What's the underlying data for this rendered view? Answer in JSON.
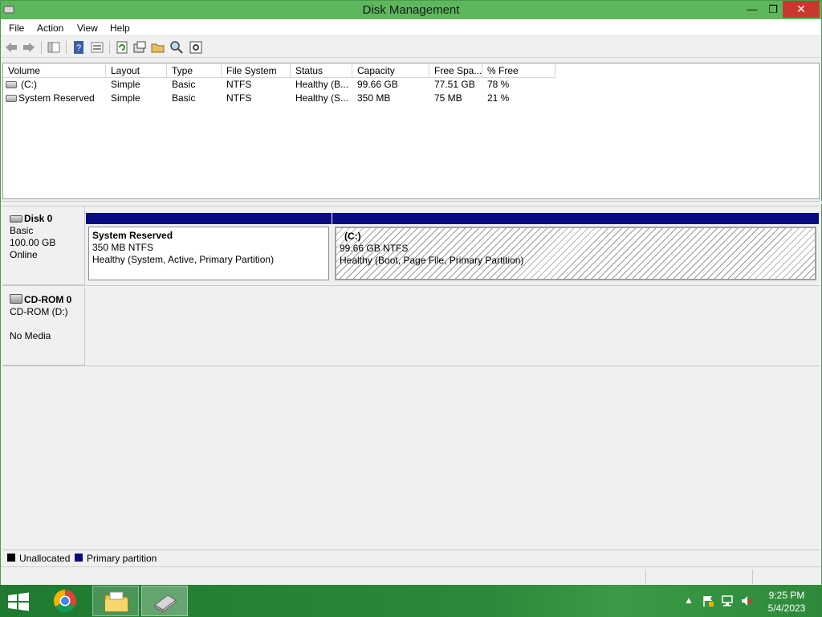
{
  "window": {
    "title": "Disk Management",
    "controls": {
      "minimize": "—",
      "maximize": "❐",
      "close": "✕"
    }
  },
  "menu": [
    "File",
    "Action",
    "View",
    "Help"
  ],
  "toolbar": {
    "icons": [
      "back-arrow-icon",
      "forward-arrow-icon",
      "properties-pane-icon",
      "help-icon",
      "show-hide-icon",
      "refresh-icon",
      "disk-properties-icon",
      "open-folder-icon",
      "search-icon",
      "settings-icon"
    ]
  },
  "volume_table": {
    "columns": [
      "Volume",
      "Layout",
      "Type",
      "File System",
      "Status",
      "Capacity",
      "Free Spa...",
      "% Free"
    ],
    "rows": [
      {
        "volume": "(C:)",
        "layout": "Simple",
        "type": "Basic",
        "fs": "NTFS",
        "status": "Healthy (B...",
        "capacity": "99.66 GB",
        "free": "77.51 GB",
        "pct": "78 %"
      },
      {
        "volume": "System Reserved",
        "layout": "Simple",
        "type": "Basic",
        "fs": "NTFS",
        "status": "Healthy (S...",
        "capacity": "350 MB",
        "free": "75 MB",
        "pct": "21 %"
      }
    ]
  },
  "disks": [
    {
      "name": "Disk 0",
      "kind": "Basic",
      "size": "100.00 GB",
      "state": "Online",
      "partitions": [
        {
          "name": "System Reserved",
          "size": "350 MB NTFS",
          "status": "Healthy (System, Active, Primary Partition)"
        },
        {
          "name": "(C:)",
          "size": "99.66 GB NTFS",
          "status": "Healthy (Boot, Page File, Primary Partition)"
        }
      ]
    },
    {
      "name": "CD-ROM 0",
      "kind": "CD-ROM (D:)",
      "state": "No Media"
    }
  ],
  "legend": {
    "items": [
      {
        "label": "Unallocated",
        "color": "#000000"
      },
      {
        "label": "Primary partition",
        "color": "#0a0a80"
      }
    ]
  },
  "taskbar": {
    "apps": [
      "start-button",
      "chrome",
      "file-explorer",
      "disk-management"
    ],
    "tray_icons": [
      "show-hidden-icons-icon",
      "action-center-flag-icon",
      "network-icon",
      "volume-muted-icon"
    ],
    "time": "9:25 PM",
    "date": "5/4/2023"
  }
}
